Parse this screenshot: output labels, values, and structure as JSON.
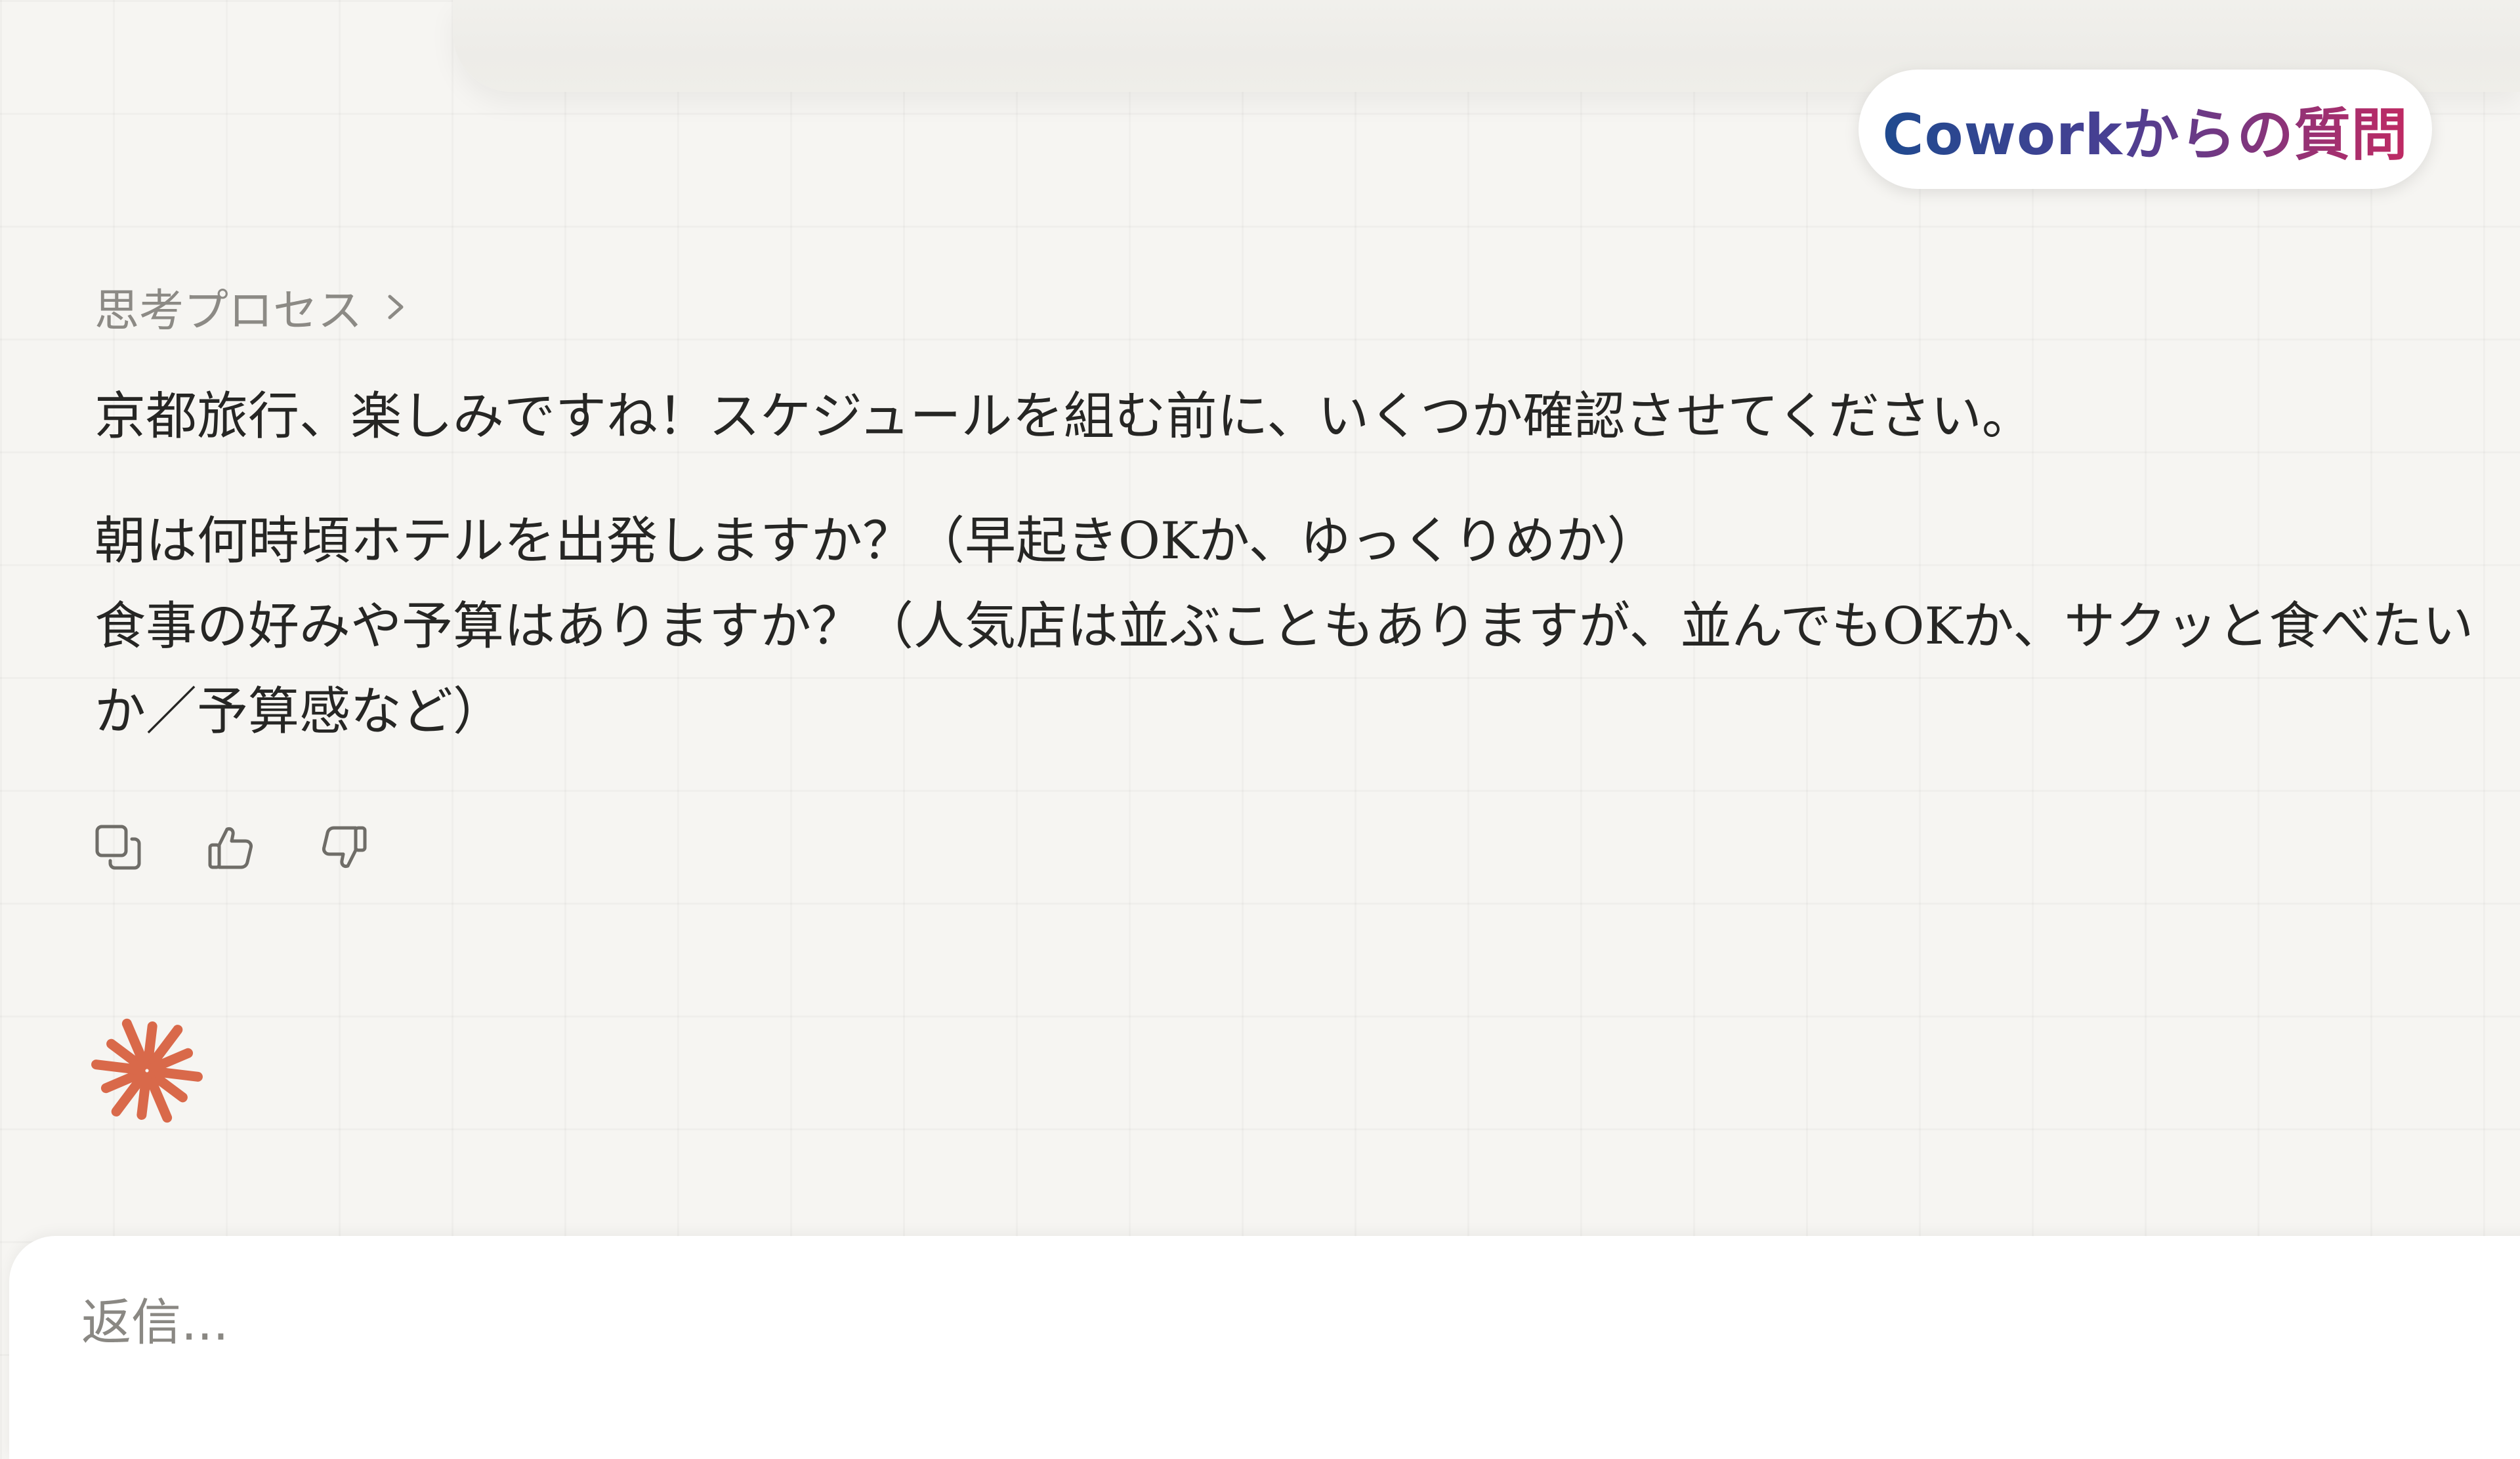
{
  "header": {
    "badge_text": "Coworkからの質問",
    "badge_gradient": [
      "#1f4a8f",
      "#4a3f93",
      "#c02a63"
    ]
  },
  "thinking": {
    "label": "思考プロセス",
    "icon": "chevron-right-icon"
  },
  "message": {
    "intro": "京都旅行、楽しみですね！スケジュールを組む前に、いくつか確認させてください。",
    "question_1": "朝は何時頃ホテルを出発しますか？（早起きOKか、ゆっくりめか）",
    "question_2": "食事の好みや予算はありますか？（人気店は並ぶこともありますが、並んでもOKか、サクッと食べたいか／予算感など）"
  },
  "actions": [
    {
      "name": "copy",
      "icon": "copy-icon"
    },
    {
      "name": "thumbs-up",
      "icon": "thumbs-up-icon"
    },
    {
      "name": "thumbs-down",
      "icon": "thumbs-down-icon"
    }
  ],
  "assistant_indicator": {
    "icon": "spark-icon",
    "color": "#d9694a"
  },
  "composer": {
    "placeholder": "返信..."
  },
  "colors": {
    "background": "#f6f5f2",
    "text": "#262624",
    "muted": "#8c8a85",
    "accent": "#d9694a"
  }
}
